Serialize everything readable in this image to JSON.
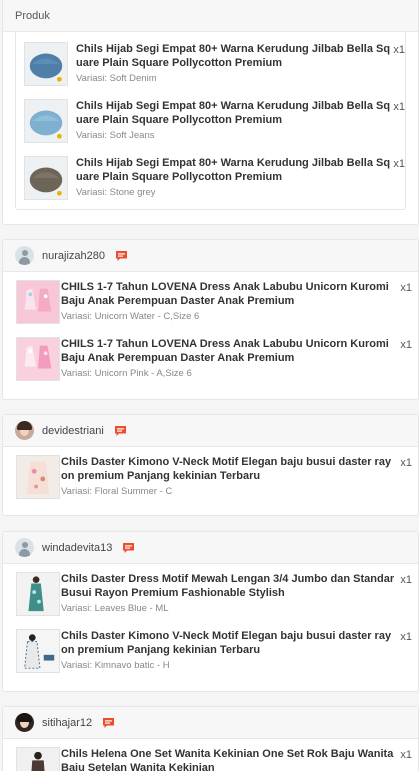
{
  "product_section": {
    "header": "Produk",
    "items": [
      {
        "name": "Chils Hijab Segi Empat 80+ Warna Kerudung Jilbab Bella Square Plain Square Pollycotton Premium",
        "variant": "Variasi: Soft Denim",
        "qty": "x1",
        "color": "#4f7fa8"
      },
      {
        "name": "Chils Hijab Segi Empat 80+ Warna Kerudung Jilbab Bella Square Plain Square Pollycotton Premium",
        "variant": "Variasi: Soft Jeans",
        "qty": "x1",
        "color": "#7fb0cf"
      },
      {
        "name": "Chils Hijab Segi Empat 80+ Warna Kerudung Jilbab Bella Square Plain Square Pollycotton Premium",
        "variant": "Variasi: Stone grey",
        "qty": "x1",
        "color": "#6e6559"
      }
    ]
  },
  "orders": [
    {
      "username": "nurajizah280",
      "avatar": "default-avatar",
      "items": [
        {
          "name": "CHILS 1-7 Tahun LOVENA Dress Anak Labubu Unicorn Kuromi Baju Anak Perempuan Daster Anak Premium",
          "variant": "Variasi: Unicorn Water - C,Size 6",
          "qty": "x1"
        },
        {
          "name": "CHILS 1-7 Tahun LOVENA Dress Anak Labubu Unicorn Kuromi Baju Anak Perempuan Daster Anak Premium",
          "variant": "Variasi: Unicorn Pink - A,Size 6",
          "qty": "x1"
        }
      ]
    },
    {
      "username": "devidestriani",
      "avatar": "photo-avatar",
      "items": [
        {
          "name": "Chils Daster Kimono V-Neck Motif Elegan baju busui daster rayon premium Panjang kekinian Terbaru",
          "variant": "Variasi: Floral Summer - C",
          "qty": "x1"
        }
      ]
    },
    {
      "username": "windadevita13",
      "avatar": "default-avatar",
      "items": [
        {
          "name": "Chils Daster Dress Motif Mewah Lengan 3/4 Jumbo dan Standar Busui Rayon Premium Fashionable Stylish",
          "variant": "Variasi: Leaves Blue - ML",
          "qty": "x1"
        },
        {
          "name": "Chils Daster Kimono V-Neck Motif Elegan baju busui daster rayon premium Panjang kekinian Terbaru",
          "variant": "Variasi: Kimnavo batic - H",
          "qty": "x1"
        }
      ]
    },
    {
      "username": "sitihajar12",
      "avatar": "photo-avatar",
      "items": [
        {
          "name": "Chils Helena One Set Wanita Kekinian One Set Rok Baju Wanita Baju Setelan Wanita Kekinian",
          "variant": "",
          "qty": "x1"
        }
      ]
    }
  ],
  "colors": {
    "chat_icon": "#ee4d2d",
    "border": "#e6e6e6",
    "header_bg": "#f7f7f7"
  }
}
